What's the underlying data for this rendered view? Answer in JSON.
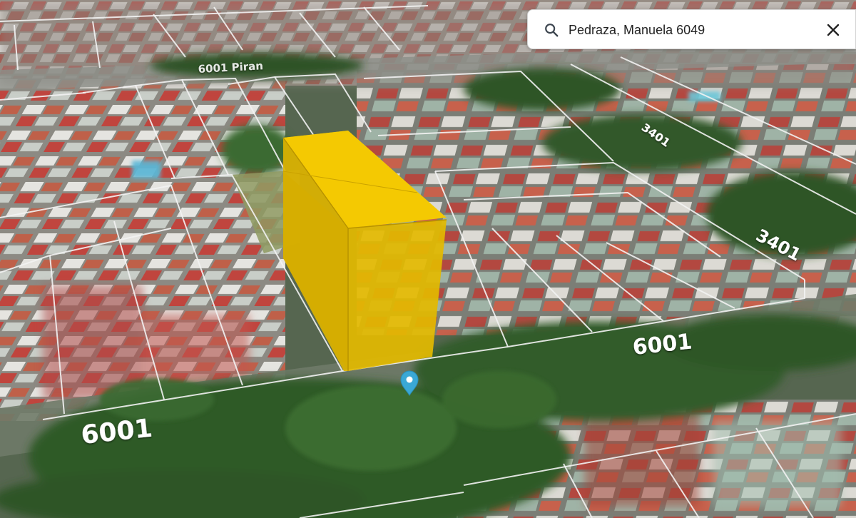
{
  "search": {
    "query": "Pedraza, Manuela 6049",
    "search_icon": "search-icon",
    "clear_icon": "close-icon"
  },
  "map": {
    "street_labels": {
      "top_left": "6001 Piran",
      "right_upper": "3401",
      "right_lower": "3401",
      "center_right": "6001",
      "bottom_left": "6001"
    },
    "selected_parcel_color": "#f5c400",
    "location_pin_icon": "map-pin-icon",
    "location_pin_color": "#3aa8d6"
  }
}
